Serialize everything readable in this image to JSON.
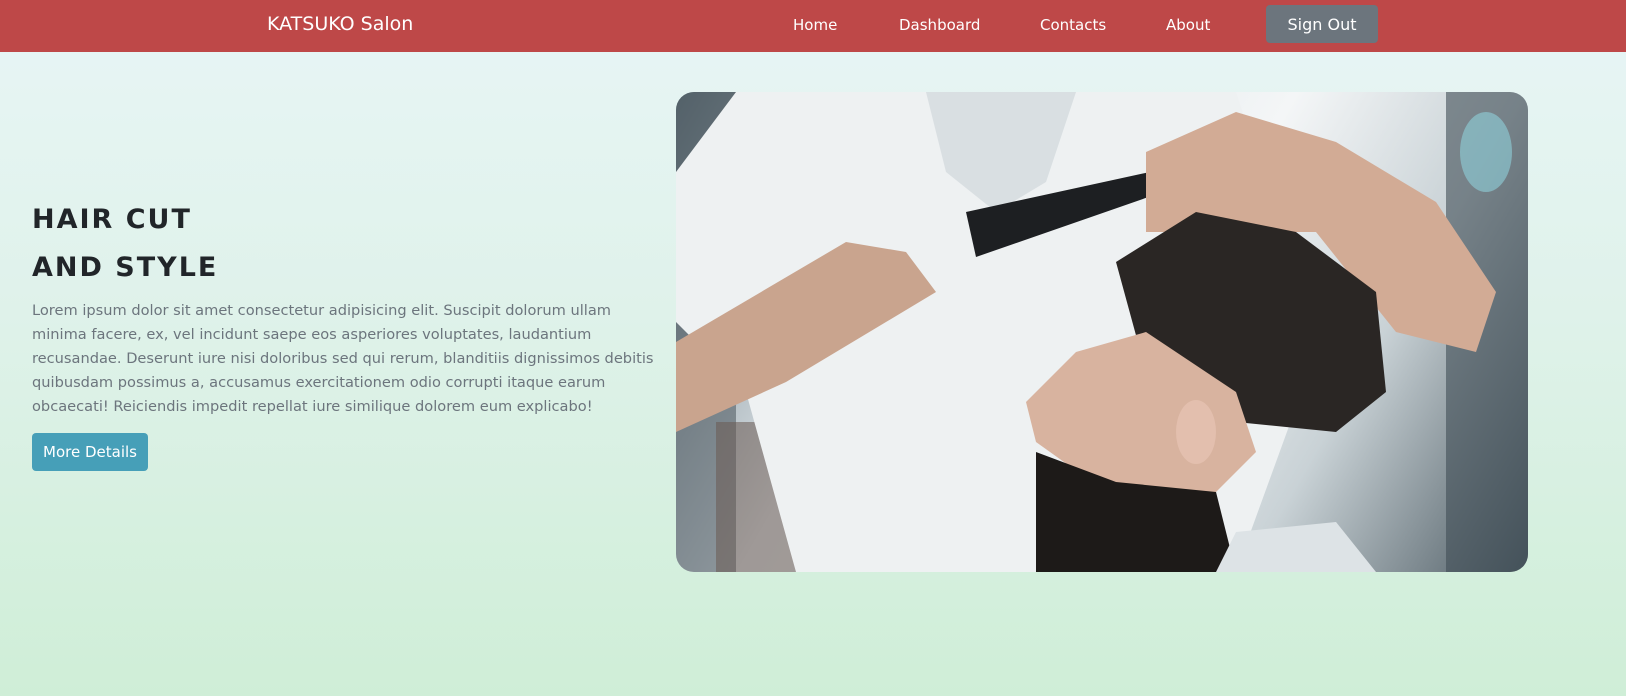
{
  "navbar": {
    "brand": "KATSUKO Salon",
    "links": [
      "Home",
      "Dashboard",
      "Contacts",
      "About"
    ],
    "signout_label": "Sign Out"
  },
  "hero": {
    "title_line1": "HAIR CUT",
    "title_line2": "AND STYLE",
    "description": "Lorem ipsum dolor sit amet consectetur adipisicing elit. Suscipit dolorum ullam minima facere, ex, vel incidunt saepe eos asperiores voluptates, laudantium recusandae. Deserunt iure nisi doloribus sed qui rerum, blanditiis dignissimos debitis quibusdam possimus a, accusamus exercitationem odio corrupti itaque earum obcaecati! Reiciendis impedit repellat iure similique dolorem eum explicabo!",
    "button_label": "More Details",
    "image": "barber-cutting-hair-photo"
  },
  "colors": {
    "navbar": "#be4848",
    "signout_button": "#6c757d",
    "primary_button": "#469fb8"
  }
}
